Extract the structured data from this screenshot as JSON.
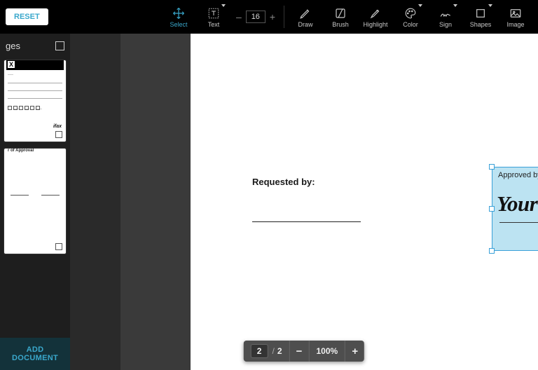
{
  "topbar": {
    "reset": "RESET",
    "tools": {
      "select": "Select",
      "text": "Text",
      "draw": "Draw",
      "brush": "Brush",
      "highlight": "Highlight",
      "color": "Color",
      "sign": "Sign",
      "shapes": "Shapes",
      "image": "Image"
    },
    "font_size": "16",
    "minus": "–",
    "plus": "+"
  },
  "sidebar": {
    "title": "ges",
    "thumb2_title": "r of Approval",
    "ifax": "ifax",
    "add_doc": "ADD DOCUMENT"
  },
  "document": {
    "requested_by": "Requested by:",
    "approved_by": "Approved by:",
    "signature_text": "Your Signature"
  },
  "pager": {
    "current": "2",
    "slash": "/",
    "total": "2",
    "minus": "−",
    "zoom": "100%",
    "plus": "+"
  }
}
